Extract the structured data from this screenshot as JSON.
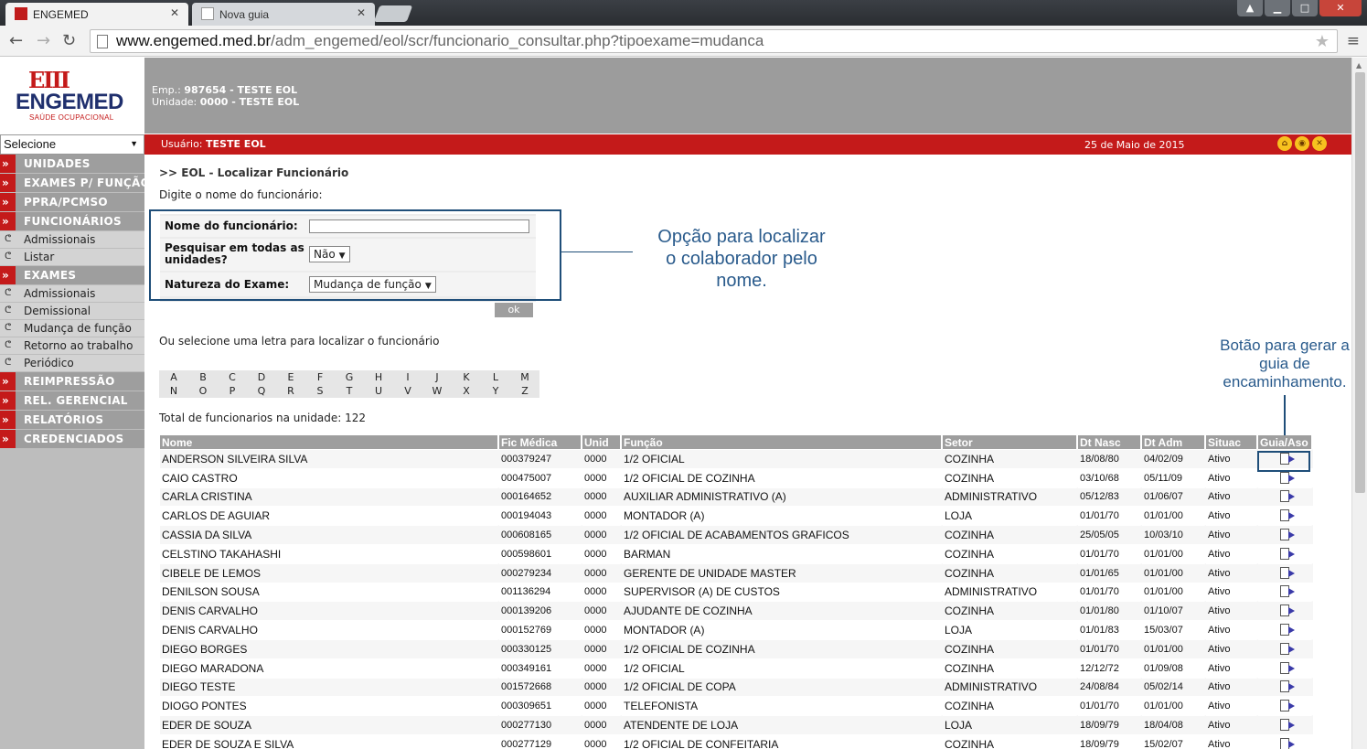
{
  "browser": {
    "tabs": [
      {
        "title": "ENGEMED",
        "active": true
      },
      {
        "title": "Nova guia",
        "active": false
      }
    ],
    "url_prefix": "www.",
    "url_host": "engemed.med.br",
    "url_path": "/adm_engemed/eol/scr/funcionario_consultar.php?tipoexame=mudanca"
  },
  "logo": {
    "mark": "EIII",
    "name": "ENGEMED",
    "tagline": "SAÚDE OCUPACIONAL"
  },
  "header": {
    "emp_label": "Emp.:",
    "emp_value": "987654 - TESTE EOL",
    "unit_label": "Unidade:",
    "unit_value": "0000 - TESTE EOL"
  },
  "topbar": {
    "select_value": "Selecione",
    "user_label": "Usuário:",
    "user_value": "TESTE EOL",
    "date": "25 de Maio de 2015"
  },
  "sidebar": {
    "sections": [
      {
        "label": "UNIDADES",
        "items": []
      },
      {
        "label": "EXAMES P/ FUNÇÃO",
        "items": []
      },
      {
        "label": "PPRA/PCMSO",
        "items": []
      },
      {
        "label": "FUNCIONÁRIOS",
        "items": [
          "Admissionais",
          "Listar"
        ]
      },
      {
        "label": "EXAMES",
        "items": [
          "Admissionais",
          "Demissional",
          "Mudança de função",
          "Retorno ao trabalho",
          "Periódico"
        ]
      },
      {
        "label": "REIMPRESSÃO",
        "items": []
      },
      {
        "label": "REL. GERENCIAL",
        "items": []
      },
      {
        "label": "RELATÓRIOS",
        "items": []
      },
      {
        "label": "CREDENCIADOS",
        "items": []
      }
    ]
  },
  "content": {
    "breadcrumb": ">> EOL - Localizar Funcionário",
    "hint": "Digite o nome do funcionário:",
    "form": {
      "name_label": "Nome do funcionário:",
      "name_value": "",
      "all_units_label_1": "Pesquisar em todas as",
      "all_units_label_2": "unidades?",
      "all_units_value": "Não",
      "nature_label": "Natureza do Exame:",
      "nature_value": "Mudança de função",
      "ok_label": "ok"
    },
    "form_callout": [
      "Opção para localizar",
      "o colaborador pelo",
      "nome."
    ],
    "letters_hint": "Ou selecione uma letra para localizar o funcionário",
    "letters_row1": [
      "A",
      "B",
      "C",
      "D",
      "E",
      "F",
      "G",
      "H",
      "I",
      "J",
      "K",
      "L",
      "M"
    ],
    "letters_row2": [
      "N",
      "O",
      "P",
      "Q",
      "R",
      "S",
      "T",
      "U",
      "V",
      "W",
      "X",
      "Y",
      "Z"
    ],
    "total": "Total de funcionarios na unidade: 122",
    "button_callout": [
      "Botão para gerar a",
      "guia de",
      "encaminhamento."
    ]
  },
  "table": {
    "columns": [
      "Nome",
      "Fic Médica",
      "Unid",
      "Função",
      "Setor",
      "Dt Nasc",
      "Dt Adm",
      "Situac",
      "Guia/Aso"
    ],
    "rows": [
      [
        "ANDERSON SILVEIRA SILVA",
        "000379247",
        "0000",
        "1/2 OFICIAL",
        "COZINHA",
        "18/08/80",
        "04/02/09",
        "Ativo"
      ],
      [
        "CAIO CASTRO",
        "000475007",
        "0000",
        "1/2 OFICIAL DE COZINHA",
        "COZINHA",
        "03/10/68",
        "05/11/09",
        "Ativo"
      ],
      [
        "CARLA CRISTINA",
        "000164652",
        "0000",
        "AUXILIAR ADMINISTRATIVO (A)",
        "ADMINISTRATIVO",
        "05/12/83",
        "01/06/07",
        "Ativo"
      ],
      [
        "CARLOS DE AGUIAR",
        "000194043",
        "0000",
        "MONTADOR (A)",
        "LOJA",
        "01/01/70",
        "01/01/00",
        "Ativo"
      ],
      [
        "CASSIA DA SILVA",
        "000608165",
        "0000",
        "1/2 OFICIAL DE ACABAMENTOS GRAFICOS",
        "COZINHA",
        "25/05/05",
        "10/03/10",
        "Ativo"
      ],
      [
        "CELSTINO TAKAHASHI",
        "000598601",
        "0000",
        "BARMAN",
        "COZINHA",
        "01/01/70",
        "01/01/00",
        "Ativo"
      ],
      [
        "CIBELE DE LEMOS",
        "000279234",
        "0000",
        "GERENTE DE UNIDADE MASTER",
        "COZINHA",
        "01/01/65",
        "01/01/00",
        "Ativo"
      ],
      [
        "DENILSON SOUSA",
        "001136294",
        "0000",
        "SUPERVISOR (A) DE CUSTOS",
        "ADMINISTRATIVO",
        "01/01/70",
        "01/01/00",
        "Ativo"
      ],
      [
        "DENIS CARVALHO",
        "000139206",
        "0000",
        "AJUDANTE DE COZINHA",
        "COZINHA",
        "01/01/80",
        "01/10/07",
        "Ativo"
      ],
      [
        "DENIS CARVALHO",
        "000152769",
        "0000",
        "MONTADOR (A)",
        "LOJA",
        "01/01/83",
        "15/03/07",
        "Ativo"
      ],
      [
        "DIEGO BORGES",
        "000330125",
        "0000",
        "1/2 OFICIAL DE COZINHA",
        "COZINHA",
        "01/01/70",
        "01/01/00",
        "Ativo"
      ],
      [
        "DIEGO MARADONA",
        "000349161",
        "0000",
        "1/2 OFICIAL",
        "COZINHA",
        "12/12/72",
        "01/09/08",
        "Ativo"
      ],
      [
        "DIEGO TESTE",
        "001572668",
        "0000",
        "1/2 OFICIAL DE COPA",
        "ADMINISTRATIVO",
        "24/08/84",
        "05/02/14",
        "Ativo"
      ],
      [
        "DIOGO PONTES",
        "000309651",
        "0000",
        "TELEFONISTA",
        "COZINHA",
        "01/01/70",
        "01/01/00",
        "Ativo"
      ],
      [
        "EDER DE SOUZA",
        "000277130",
        "0000",
        "ATENDENTE DE LOJA",
        "LOJA",
        "18/09/79",
        "18/04/08",
        "Ativo"
      ],
      [
        "EDER DE SOUZA E SILVA",
        "000277129",
        "0000",
        "1/2 OFICIAL DE CONFEITARIA",
        "COZINHA",
        "18/09/79",
        "15/02/07",
        "Ativo"
      ]
    ]
  },
  "colors": {
    "brand_red": "#c41a1a",
    "grey": "#9e9e9e",
    "callout_blue": "#1f4e79"
  }
}
